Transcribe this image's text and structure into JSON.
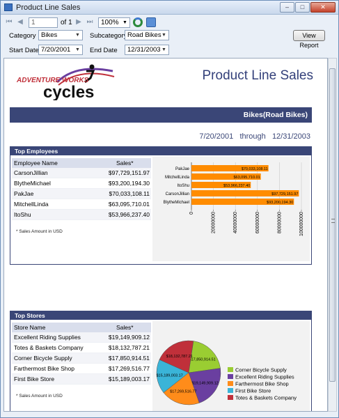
{
  "window": {
    "title": "Product Line Sales"
  },
  "toolbar": {
    "page_current": "1",
    "page_of": "of 1",
    "zoom": "100%"
  },
  "params": {
    "category_label": "Category",
    "category_value": "Bikes",
    "subcategory_label": "Subcategory",
    "subcategory_value": "Road Bikes",
    "start_date_label": "Start Date",
    "start_date_value": "7/20/2001",
    "end_date_label": "End Date",
    "end_date_value": "12/31/2003",
    "view_report": "View Report"
  },
  "report": {
    "logo_top": "ADVENTURE WORKS",
    "logo_bottom": "cycles",
    "title": "Product Line Sales",
    "band": "Bikes(Road Bikes)",
    "date_from": "7/20/2001",
    "date_through": "through",
    "date_to": "12/31/2003"
  },
  "employees": {
    "heading": "Top Employees",
    "col_name": "Employee Name",
    "col_sales": "Sales*",
    "rows": [
      {
        "name": "CarsonJillian",
        "sales": "$97,729,151.97"
      },
      {
        "name": "BlytheMichael",
        "sales": "$93,200,194.30"
      },
      {
        "name": "PakJae",
        "sales": "$70,033,108.11"
      },
      {
        "name": "MitchellLinda",
        "sales": "$63,095,710.01"
      },
      {
        "name": "ItoShu",
        "sales": "$53,966,237.40"
      }
    ],
    "footnote": "* Sales Amount in USD"
  },
  "stores": {
    "heading": "Top Stores",
    "col_name": "Store Name",
    "col_sales": "Sales*",
    "rows": [
      {
        "name": "Excellent Riding Supplies",
        "sales": "$19,149,909.12"
      },
      {
        "name": "Totes & Baskets Company",
        "sales": "$18,132,787.21"
      },
      {
        "name": "Corner Bicycle Supply",
        "sales": "$17,850,914.51"
      },
      {
        "name": "Farthermost Bike Shop",
        "sales": "$17,269,516.77"
      },
      {
        "name": "First Bike Store",
        "sales": "$15,189,003.17"
      }
    ],
    "footnote": "* Sales Amount in USD"
  },
  "chart_data": [
    {
      "type": "bar",
      "orientation": "horizontal",
      "categories": [
        "PakJae",
        "MitchellLinda",
        "ItoShu",
        "CarsonJillian",
        "BlytheMichael"
      ],
      "values": [
        70033108.11,
        63095710.01,
        53966237.4,
        97729151.97,
        93200194.3
      ],
      "data_labels": [
        "$70,033,108.11",
        "$63,095,710.01",
        "$53,966,237.40",
        "$97,729,151.97",
        "$93,200,194.30"
      ],
      "x_ticks": [
        0,
        20000000,
        40000000,
        60000000,
        80000000,
        100000000
      ],
      "x_tick_labels": [
        "0",
        "20000000",
        "40000000",
        "60000000",
        "80000000",
        "100000000"
      ],
      "xlim": [
        0,
        100000000
      ],
      "bar_color": "#ff8c00",
      "grid": true
    },
    {
      "type": "pie",
      "categories": [
        "Corner Bicycle Supply",
        "Excellent Riding Supplies",
        "Farthermost Bike Shop",
        "First Bike Store",
        "Totes & Baskets Company"
      ],
      "values": [
        17850914.51,
        19149909.12,
        17269516.77,
        15189003.17,
        18132787.21
      ],
      "data_labels": [
        "$17,850,914.51",
        "$19,149,909.12",
        "$17,269,516.77",
        "$15,189,003.17",
        "$18,132,787.21"
      ],
      "colors": [
        "#9acd32",
        "#6a3fa0",
        "#ff8c1a",
        "#3ab4d8",
        "#c0303a"
      ],
      "legend": "right"
    }
  ]
}
